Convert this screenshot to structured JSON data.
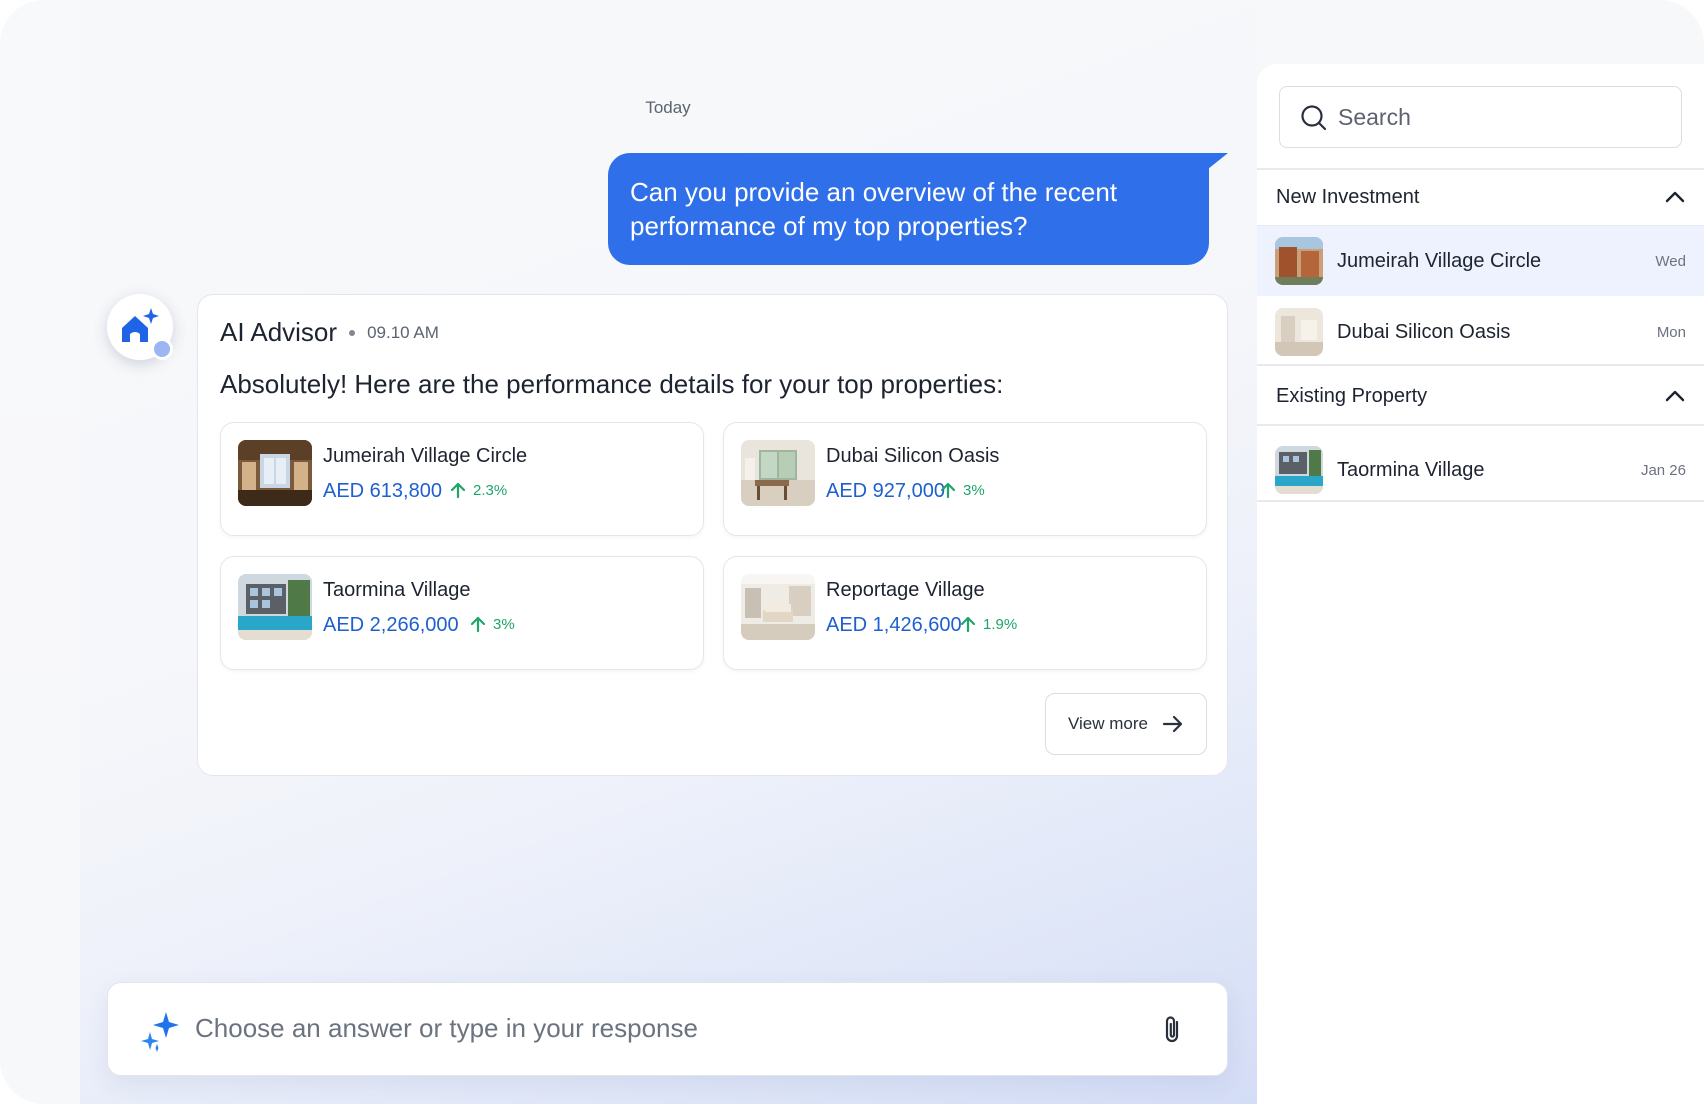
{
  "chat": {
    "date_separator": "Today",
    "user_message": "Can you provide an overview of the recent performance of my top properties?",
    "advisor": {
      "name": "AI Advisor",
      "time": "09.10 AM",
      "message": "Absolutely! Here are the performance details for your top properties:",
      "properties": [
        {
          "name": "Jumeirah Village Circle",
          "price": "AED 613,800",
          "change": "2.3%",
          "thumb_icon": "living-room-photo"
        },
        {
          "name": "Dubai Silicon Oasis",
          "price": "AED 927,000",
          "change": "3%",
          "thumb_icon": "dining-room-photo"
        },
        {
          "name": "Taormina Village",
          "price": "AED 2,266,000",
          "change": "3%",
          "thumb_icon": "pool-villa-photo"
        },
        {
          "name": "Reportage Village",
          "price": "AED 1,426,600",
          "change": "1.9%",
          "thumb_icon": "bright-lounge-photo"
        }
      ],
      "view_more_label": "View more"
    },
    "input_placeholder": "Choose an answer or type in your response"
  },
  "sidebar": {
    "search_placeholder": "Search",
    "sections": [
      {
        "title": "New Investment",
        "items": [
          {
            "name": "Jumeirah Village Circle",
            "date": "Wed",
            "active": true
          },
          {
            "name": "Dubai Silicon Oasis",
            "date": "Mon",
            "active": false
          }
        ]
      },
      {
        "title": "Existing Property",
        "items": [
          {
            "name": "Taormina Village",
            "date": "Jan 26",
            "active": false
          }
        ]
      }
    ]
  },
  "colors": {
    "accent_blue": "#2f6fea",
    "price_blue": "#1f5fcf",
    "positive_green": "#1fa56a",
    "active_row": "#edf2fe"
  }
}
